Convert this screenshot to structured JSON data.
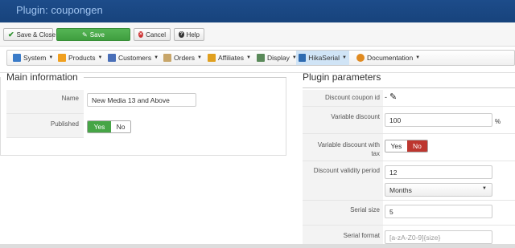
{
  "header": {
    "title": "Plugin: coupongen"
  },
  "toolbar": {
    "save_close": "Save & Close",
    "save": "Save",
    "cancel": "Cancel",
    "help": "Help"
  },
  "menu": {
    "items": [
      {
        "label": "System",
        "icon": "gear-icon"
      },
      {
        "label": "Products",
        "icon": "box-icon"
      },
      {
        "label": "Customers",
        "icon": "users-icon"
      },
      {
        "label": "Orders",
        "icon": "orders-icon"
      },
      {
        "label": "Affiliates",
        "icon": "affiliates-icon"
      },
      {
        "label": "Display",
        "icon": "display-icon"
      },
      {
        "label": "HikaSerial",
        "icon": "serial-icon"
      },
      {
        "label": "Documentation",
        "icon": "docs-icon"
      }
    ]
  },
  "main": {
    "legend": "Main information",
    "name_label": "Name",
    "name_value": "New Media 13 and Above",
    "published_label": "Published",
    "published_yes": "Yes",
    "published_no": "No"
  },
  "plugin": {
    "legend": "Plugin parameters",
    "discount_coupon_label": "Discount coupon id",
    "discount_coupon_value": "-",
    "variable_discount_label": "Variable discount",
    "variable_discount_value": "100",
    "variable_discount_unit": "%",
    "variable_tax_label_1": "Variable discount with",
    "variable_tax_label_2": "tax",
    "variable_tax_yes": "Yes",
    "variable_tax_no": "No",
    "validity_label": "Discount validity period",
    "validity_value": "12",
    "validity_unit": "Months",
    "serial_size_label": "Serial size",
    "serial_size_value": "5",
    "serial_format_label": "Serial format",
    "serial_format_placeholder": "[a-zA-Z0-9]{size}"
  }
}
